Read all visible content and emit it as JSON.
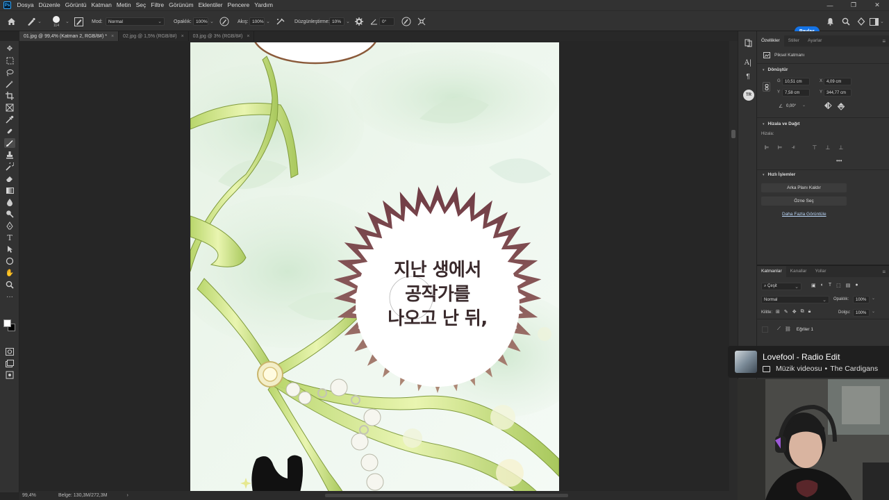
{
  "menu": [
    "Dosya",
    "Düzenle",
    "Görüntü",
    "Katman",
    "Metin",
    "Seç",
    "Filtre",
    "Görünüm",
    "Eklentiler",
    "Pencere",
    "Yardım"
  ],
  "options": {
    "brush_size": "114",
    "mode_label": "Mod:",
    "mode_value": "Normal",
    "opacity_label": "Opaklık:",
    "opacity_value": "100%",
    "flow_label": "Akış:",
    "flow_value": "100%",
    "smoothing_label": "Düzgünleştirme:",
    "smoothing_value": "10%",
    "angle_value": "0°",
    "share_label": "Paylaş"
  },
  "tabs": [
    {
      "label": "01.jpg @ 99,4% (Katman 2, RGB/8#) *",
      "active": true
    },
    {
      "label": "02.jpg @ 1,5% (RGB/8#)",
      "active": false
    },
    {
      "label": "03.jpg @ 3% (RGB/8#)",
      "active": false
    }
  ],
  "canvas": {
    "bubble_lines": [
      "지난 생에서",
      "공작가를",
      "나오고 난 뒤,"
    ]
  },
  "status": {
    "zoom": "99,4%",
    "doc_info": "Belge: 130,3M/272,3M"
  },
  "properties": {
    "tabs": [
      "Özellikler",
      "Stiller",
      "Ayarlar"
    ],
    "layer_kind": "Piksel Katmanı",
    "transform_title": "Dönüştür",
    "w_label": "G",
    "w_value": "10,51 cm",
    "x_label": "X",
    "x_value": "4,09 cm",
    "h_label": "Y",
    "h_value": "7,58 cm",
    "y_label": "Y",
    "y_value": "344,77 cm",
    "angle_value": "0,00°",
    "align_title": "Hizala ve Dağıt",
    "align_label": "Hizala:",
    "more": "•••",
    "quick_title": "Hızlı İşlemler",
    "btn_remove_bg": "Arka Planı Kaldır",
    "btn_select_subject": "Özne Seç",
    "show_more": "Daha Fazla Görüntüle"
  },
  "layers": {
    "tabs": [
      "Katmanlar",
      "Kanallar",
      "Yollar"
    ],
    "filter_value": "Çeşit",
    "blend_value": "Normal",
    "opacity_label": "Opaklık:",
    "opacity_value": "100%",
    "lock_label": "Kilitle:",
    "fill_label": "Dolgu:",
    "fill_value": "100%",
    "item_name": "Eğriler 1"
  },
  "media": {
    "title": "Lovefool - Radio Edit",
    "type": "Müzik videosu",
    "sep": "•",
    "artist": "The Cardigans"
  },
  "colors": {
    "accent": "#1473e6",
    "bubble_outer": "#7a3f45",
    "bubble_text": "#3a2a2c"
  }
}
